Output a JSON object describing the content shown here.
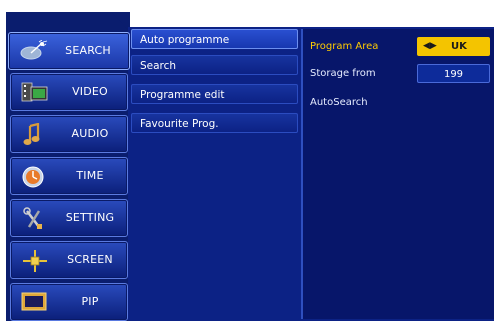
{
  "left_menu": [
    {
      "label": "SEARCH",
      "icon": "satellite-dish-icon"
    },
    {
      "label": "VIDEO",
      "icon": "film-monitor-icon"
    },
    {
      "label": "AUDIO",
      "icon": "music-note-icon"
    },
    {
      "label": "TIME",
      "icon": "clock-icon"
    },
    {
      "label": "SETTING",
      "icon": "tools-icon"
    },
    {
      "label": "SCREEN",
      "icon": "crosshair-icon"
    },
    {
      "label": "PIP",
      "icon": "pip-screen-icon"
    }
  ],
  "sub_menu": [
    {
      "label": "Auto programme"
    },
    {
      "label": "Search"
    },
    {
      "label": "Programme edit"
    },
    {
      "label": "Favourite Prog."
    }
  ],
  "settings": {
    "program_area_label": "Program Area",
    "program_area_value": "UK",
    "storage_from_label": "Storage from",
    "storage_from_value": "199",
    "autosearch_label": "AutoSearch"
  },
  "colors": {
    "accent": "#f4c400",
    "panel": "#0c2285"
  }
}
